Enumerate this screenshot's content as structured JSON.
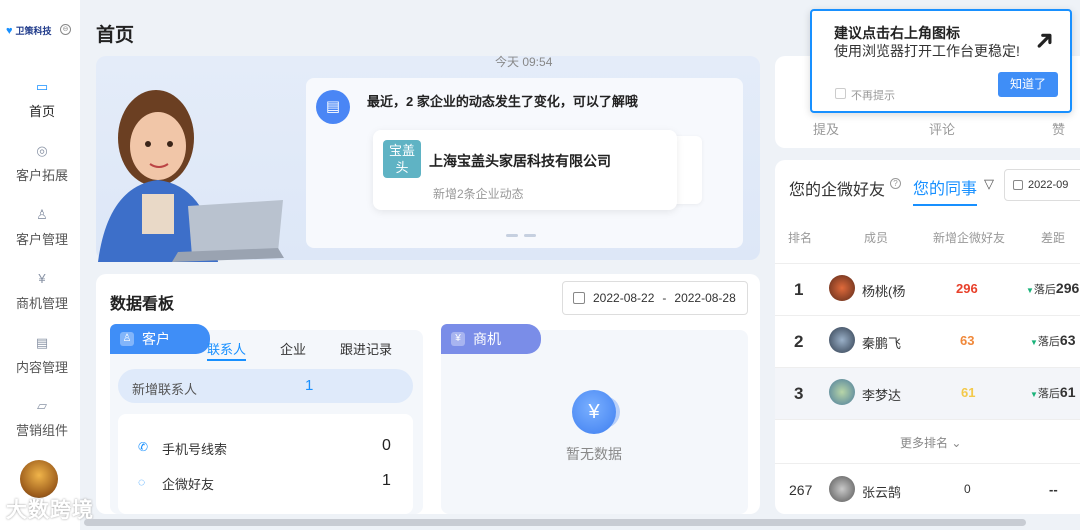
{
  "app": {
    "logo": "卫策科技",
    "badge": "⊖"
  },
  "sidebar": {
    "items": [
      {
        "label": "首页",
        "icon": "home-icon"
      },
      {
        "label": "客户拓展",
        "icon": "customer-expand-icon"
      },
      {
        "label": "客户管理",
        "icon": "user-icon"
      },
      {
        "label": "商机管理",
        "icon": "yen-icon"
      },
      {
        "label": "内容管理",
        "icon": "document-icon"
      },
      {
        "label": "营销组件",
        "icon": "folder-icon"
      }
    ]
  },
  "watermark": "大数跨境",
  "page_title": "首页",
  "hero": {
    "time": "今天 09:54",
    "message": "最近，2 家企业的动态发生了变化，可以了解哦",
    "company_logo": "宝盖头",
    "company_name": "上海宝盖头家居科技有限公司",
    "company_sub": "新增2条企业动态"
  },
  "board": {
    "title": "数据看板",
    "date_start": "2022-08-22",
    "date_sep": "-",
    "date_end": "2022-08-28",
    "customer": {
      "tag": "客户",
      "tabs": [
        "联系人",
        "企业",
        "跟进记录"
      ],
      "highlight_label": "新增联系人",
      "highlight_value": "1",
      "items": [
        {
          "label": "手机号线索",
          "value": "0"
        },
        {
          "label": "企微好友",
          "value": "1"
        }
      ]
    },
    "opportunity": {
      "tag": "商机",
      "empty": "暂无数据"
    }
  },
  "notification": {
    "title": "建议点击右上角图标",
    "text": "使用浏览器打开工作台更稳定!",
    "checkbox": "不再提示",
    "button": "知道了"
  },
  "stats": {
    "labels": [
      "提及",
      "评论",
      "赞"
    ]
  },
  "ranking": {
    "tab1": "您的企微好友",
    "tab2": "您的同事",
    "date": "2022-09",
    "headers": [
      "排名",
      "成员",
      "新增企微好友",
      "差距"
    ],
    "rows": [
      {
        "rank": "1",
        "name": "杨桃(杨",
        "count": "296",
        "gap_label": "落后",
        "gap": "296",
        "color": "#e8402a"
      },
      {
        "rank": "2",
        "name": "秦鹏飞",
        "count": "63",
        "gap_label": "落后",
        "gap": "63",
        "color": "#f0883a"
      },
      {
        "rank": "3",
        "name": "李梦达",
        "count": "61",
        "gap_label": "落后",
        "gap": "61",
        "color": "#f3c94a"
      }
    ],
    "more": "更多排名",
    "self": {
      "rank": "267",
      "name": "张云鹄",
      "count": "0",
      "gap": "--"
    }
  }
}
